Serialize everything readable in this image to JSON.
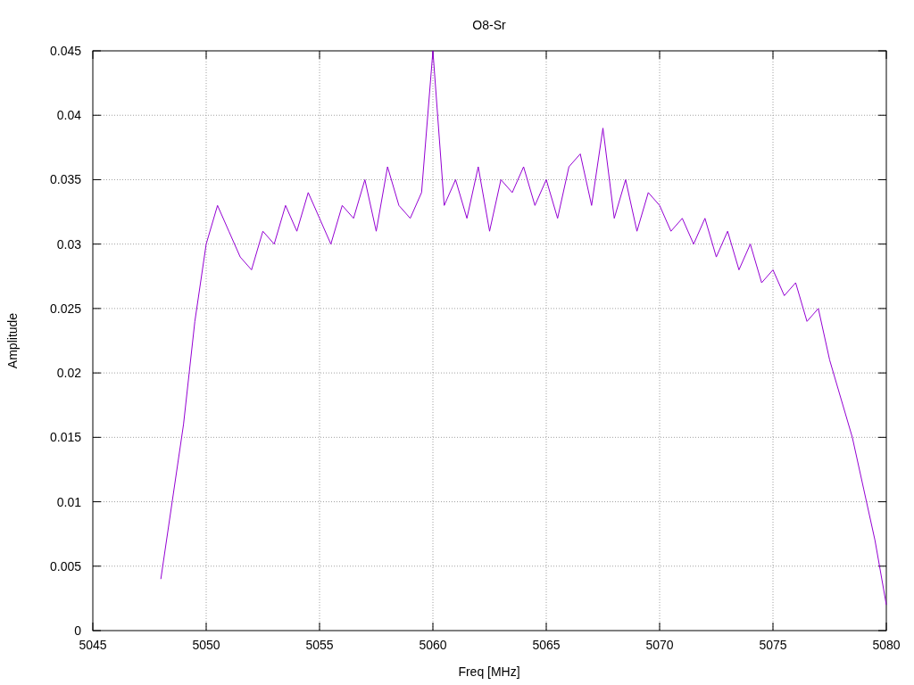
{
  "chart_data": {
    "type": "line",
    "title": "O8-Sr",
    "xlabel": "Freq [MHz]",
    "ylabel": "Amplitude",
    "x": [
      5048,
      5048.5,
      5049,
      5049.5,
      5050,
      5050.5,
      5051,
      5051.5,
      5052,
      5052.5,
      5053,
      5053.5,
      5054,
      5054.5,
      5055,
      5055.5,
      5056,
      5056.5,
      5057,
      5057.5,
      5058,
      5058.5,
      5059,
      5059.5,
      5060,
      5060.5,
      5061,
      5061.5,
      5062,
      5062.5,
      5063,
      5063.5,
      5064,
      5064.5,
      5065,
      5065.5,
      5066,
      5066.5,
      5067,
      5067.5,
      5068,
      5068.5,
      5069,
      5069.5,
      5070,
      5070.5,
      5071,
      5071.5,
      5072,
      5072.5,
      5073,
      5073.5,
      5074,
      5074.5,
      5075,
      5075.5,
      5076,
      5076.5,
      5077,
      5077.5,
      5078,
      5078.5,
      5079,
      5079.5,
      5080
    ],
    "series": [
      {
        "color": "#9400d3",
        "values": [
          0.004,
          0.01,
          0.016,
          0.024,
          0.03,
          0.033,
          0.031,
          0.029,
          0.028,
          0.031,
          0.03,
          0.033,
          0.031,
          0.034,
          0.032,
          0.03,
          0.033,
          0.032,
          0.035,
          0.031,
          0.036,
          0.033,
          0.032,
          0.034,
          0.045,
          0.033,
          0.035,
          0.032,
          0.036,
          0.031,
          0.035,
          0.034,
          0.036,
          0.033,
          0.035,
          0.032,
          0.036,
          0.037,
          0.033,
          0.039,
          0.032,
          0.035,
          0.031,
          0.034,
          0.033,
          0.031,
          0.032,
          0.03,
          0.032,
          0.029,
          0.031,
          0.028,
          0.03,
          0.027,
          0.028,
          0.026,
          0.027,
          0.024,
          0.025,
          0.021,
          0.018,
          0.015,
          0.011,
          0.007,
          0.002
        ]
      }
    ],
    "grid": true,
    "xlim": [
      5045,
      5080
    ],
    "ylim": [
      0,
      0.045
    ],
    "xticks": [
      5045,
      5050,
      5055,
      5060,
      5065,
      5070,
      5075,
      5080
    ],
    "yticks": [
      0,
      0.005,
      0.01,
      0.015,
      0.02,
      0.025,
      0.03,
      0.035,
      0.04,
      0.045
    ]
  }
}
